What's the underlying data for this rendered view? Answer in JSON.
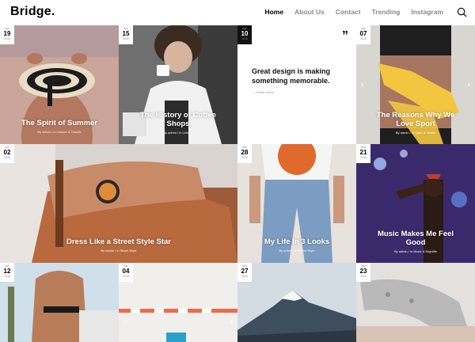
{
  "logo": "Bridge.",
  "nav": [
    "Home",
    "About Us",
    "Contact",
    "Trending",
    "Instagram"
  ],
  "quote": {
    "text": "Great design is making something memorable.",
    "author": "— Ellette Harris"
  },
  "posts": [
    {
      "day": "19",
      "month": "Apr",
      "year": "2016",
      "title": "The Spirit of Summer",
      "meta": "By admin  /  in Leisure & Travels"
    },
    {
      "day": "15",
      "month": "Apr",
      "year": "2016",
      "title": "The History of Coffee Shops",
      "meta": "By admin  /  in Leisure"
    },
    {
      "day": "10",
      "month": "Apr",
      "year": "2016"
    },
    {
      "day": "07",
      "month": "Apr",
      "year": "2016",
      "title": "The Reasons Why We Love Sport",
      "meta": "By admin  /  in Sport & Health"
    },
    {
      "day": "02",
      "month": "Apr",
      "year": "2016",
      "title": "Dress Like a Street Style Star",
      "meta": "By admin  /  in Street Style"
    },
    {
      "day": "28",
      "month": "Mar",
      "year": "2016",
      "title": "My Life In 3 Looks",
      "meta": "By admin  /  in Street Style"
    },
    {
      "day": "21",
      "month": "Mar",
      "year": "2016",
      "title": "Music Makes Me Feel Good",
      "meta": "By admin  /  in Music & Nightlife"
    },
    {
      "day": "12",
      "month": "Apr",
      "year": "2016"
    },
    {
      "day": "04",
      "month": "Apr",
      "year": "2016"
    },
    {
      "day": "27",
      "month": "Mar",
      "year": "2016"
    },
    {
      "day": "23",
      "month": "Mar",
      "year": "2016"
    }
  ],
  "colors": {
    "accent": "#000000",
    "nav_muted": "#8a8a8a"
  }
}
